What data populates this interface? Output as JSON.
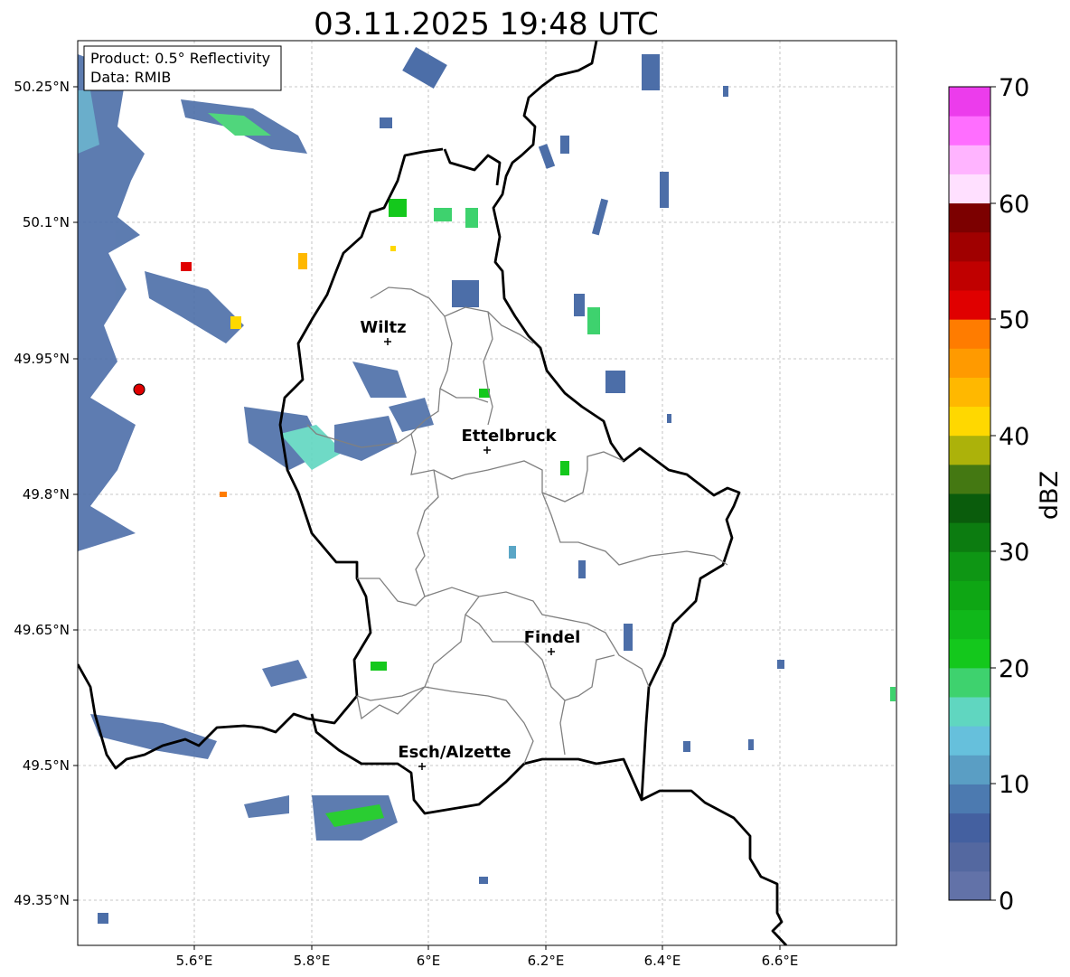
{
  "title": "03.11.2025 19:48 UTC",
  "info_box": {
    "product": "Product: 0.5° Reflectivity",
    "source": "Data: RMIB"
  },
  "axes": {
    "lat_ticks": [
      "50.25°N",
      "50.1°N",
      "49.95°N",
      "49.8°N",
      "49.65°N",
      "49.5°N",
      "49.35°N"
    ],
    "lon_ticks": [
      "5.6°E",
      "5.8°E",
      "6°E",
      "6.2°E",
      "6.4°E",
      "6.6°E"
    ]
  },
  "cities": [
    {
      "name": "Wiltz"
    },
    {
      "name": "Ettelbruck"
    },
    {
      "name": "Findel"
    },
    {
      "name": "Esch/Alzette"
    }
  ],
  "colorbar": {
    "unit": "dBZ",
    "ticks": [
      "70",
      "60",
      "50",
      "40",
      "30",
      "20",
      "10",
      "0"
    ],
    "colors": [
      "#6272a8",
      "#5468a0",
      "#4460a0",
      "#4c7ab0",
      "#5a9ec4",
      "#66c0dc",
      "#60d6c0",
      "#3ed26e",
      "#14c81c",
      "#10b81a",
      "#0ea614",
      "#0e9614",
      "#0c7c10",
      "#0a5c0c",
      "#447812",
      "#acb20a",
      "#ffd800",
      "#ffb800",
      "#ff9a00",
      "#ff7c00",
      "#e00000",
      "#c00000",
      "#a00000",
      "#7c0000",
      "#ffe0ff",
      "#ffb4ff",
      "#ff6eff",
      "#ec3cec"
    ]
  }
}
